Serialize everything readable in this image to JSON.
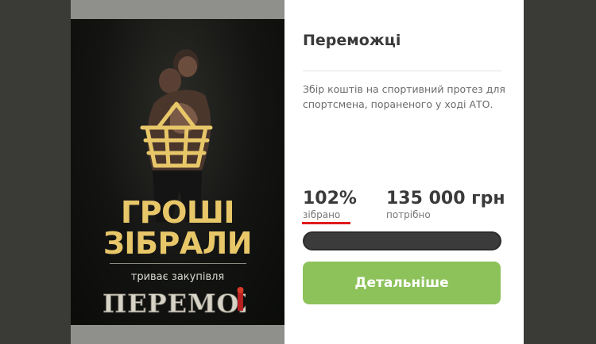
{
  "poster": {
    "headline_line1": "ГРОШІ",
    "headline_line2": "ЗІБРАЛИ",
    "subline": "триває закупівля",
    "logo_text": "ПЕРЕМОЖЦІ",
    "accent_color": "#e8c769",
    "icon": "basket-icon"
  },
  "card": {
    "title": "Переможці",
    "description": "Збір коштів на спортивний протез для спортсмена, пораненого у ході АТО.",
    "percent": "102%",
    "percent_label": "зібрано",
    "amount": "135 000 грн",
    "amount_label": "потрібно",
    "progress": 1.0,
    "button_label": "Детальніше",
    "button_color": "#8dc25b",
    "underline_color": "#e01b1b"
  }
}
